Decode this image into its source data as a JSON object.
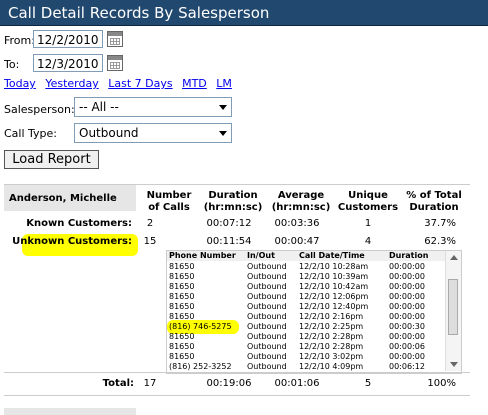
{
  "title": "Call Detail Records By Salesperson",
  "filters": {
    "from_label": "From:",
    "from_value": "12/2/2010",
    "to_label": "To:",
    "to_value": "12/3/2010",
    "quick_links": [
      "Today",
      "Yesterday",
      "Last 7 Days",
      "MTD",
      "LM"
    ],
    "salesperson_label": "Salesperson:",
    "salesperson_value": "-- All --",
    "calltype_label": "Call Type:",
    "calltype_value": "Outbound",
    "load_button": "Load Report"
  },
  "report": {
    "salesperson": "Anderson, Michelle",
    "headers": {
      "calls": [
        "Number",
        "of Calls"
      ],
      "duration": [
        "Duration",
        "(hr:mn:sc)"
      ],
      "average": [
        "Average",
        "(hr:mn:sc)"
      ],
      "unique": [
        "Unique",
        "Customers"
      ],
      "pct": [
        "% of Total",
        "Duration"
      ]
    },
    "rows": [
      {
        "label": "Known Customers:",
        "calls": "2",
        "duration": "00:07:12",
        "average": "00:03:36",
        "unique": "1",
        "pct": "37.7%"
      },
      {
        "label": "Unknown Customers:",
        "calls": "15",
        "duration": "00:11:54",
        "average": "00:00:47",
        "unique": "4",
        "pct": "62.3%"
      }
    ],
    "total": {
      "label": "Total:",
      "calls": "17",
      "duration": "00:19:06",
      "average": "00:01:06",
      "unique": "5",
      "pct": "100%"
    }
  },
  "detail": {
    "headers": [
      "Phone Number",
      "In/Out",
      "Call Date/Time",
      "Duration"
    ],
    "rows": [
      [
        "81650",
        "Outbound",
        "12/2/10 10:28am",
        "00:00:00"
      ],
      [
        "81650",
        "Outbound",
        "12/2/10 10:39am",
        "00:00:00"
      ],
      [
        "81650",
        "Outbound",
        "12/2/10 10:42am",
        "00:00:00"
      ],
      [
        "81650",
        "Outbound",
        "12/2/10 12:06pm",
        "00:00:00"
      ],
      [
        "81650",
        "Outbound",
        "12/2/10 12:40pm",
        "00:00:00"
      ],
      [
        "81650",
        "Outbound",
        "12/2/10 2:16pm",
        "00:00:00"
      ],
      [
        "(816) 746-5275",
        "Outbound",
        "12/2/10 2:25pm",
        "00:00:30"
      ],
      [
        "81650",
        "Outbound",
        "12/2/10 2:28pm",
        "00:00:00"
      ],
      [
        "81650",
        "Outbound",
        "12/2/10 2:28pm",
        "00:00:06"
      ],
      [
        "81650",
        "Outbound",
        "12/2/10 3:02pm",
        "00:00:00"
      ],
      [
        "(816) 252-3252",
        "Outbound",
        "12/2/10 4:09pm",
        "00:06:12"
      ]
    ]
  },
  "colors": {
    "header_bg": "#21486e",
    "highlight": "#ffff00",
    "link": "#0000ee"
  }
}
